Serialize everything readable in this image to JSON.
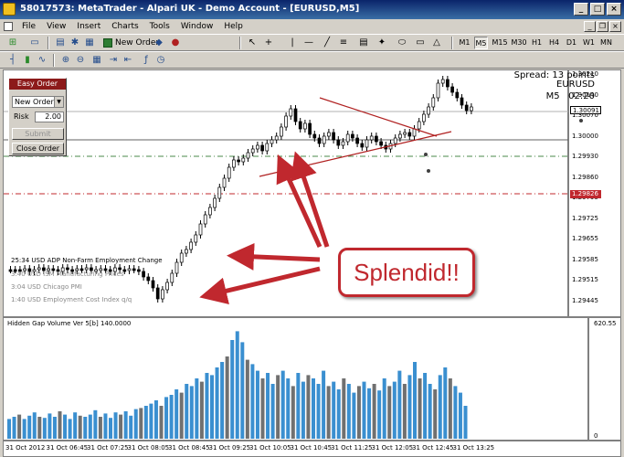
{
  "window": {
    "title": "58017573: MetaTrader - Alpari UK - Demo Account - [EURUSD,M5]"
  },
  "menu": [
    "File",
    "View",
    "Insert",
    "Charts",
    "Tools",
    "Window",
    "Help"
  ],
  "toolbar": {
    "new_order_label": "New Order",
    "timeframes": [
      "M1",
      "M5",
      "M15",
      "M30",
      "H1",
      "H4",
      "D1",
      "W1",
      "MN"
    ],
    "active_timeframe": "M5"
  },
  "chart": {
    "spread": "Spread: 13 points",
    "symbol": "EURUSD",
    "timeframe": "M5",
    "countdown": "02:20",
    "price_levels": [
      "1.30210",
      "1.30140",
      "1.30070",
      "1.30000",
      "1.29930",
      "1.29860",
      "1.29795",
      "1.29725",
      "1.29655",
      "1.29585",
      "1.29515",
      "1.29445"
    ],
    "current_price": "1.30091",
    "red_line_price": "1.29826",
    "news": [
      {
        "text": "25:34  USD  ADP Non-Farm Employment Change",
        "faded": false
      },
      {
        "text": "3:40  USD  ISM Manufacturing Prices",
        "faded": true
      },
      {
        "text": "3:04  USD  Chicago PMI",
        "faded": true
      },
      {
        "text": "1:40  USD  Employment Cost Index q/q",
        "faded": true
      }
    ],
    "annotation": "Splendid!!"
  },
  "easy_order": {
    "title": "Easy Order",
    "order_type": "New Order",
    "risk_label": "Risk",
    "risk_value": "2.00",
    "submit_label": "Submit",
    "close_label": "Close Order"
  },
  "indicator": {
    "title": "Hidden Gap Volume Ver 5[b] 140.0000",
    "max_label": "620.55",
    "zero_label": "0",
    "bars": [
      {
        "v": 0.18,
        "c": "b"
      },
      {
        "v": 0.2,
        "c": "b"
      },
      {
        "v": 0.22,
        "c": "g"
      },
      {
        "v": 0.18,
        "c": "b"
      },
      {
        "v": 0.21,
        "c": "b"
      },
      {
        "v": 0.24,
        "c": "b"
      },
      {
        "v": 0.2,
        "c": "g"
      },
      {
        "v": 0.19,
        "c": "b"
      },
      {
        "v": 0.23,
        "c": "b"
      },
      {
        "v": 0.2,
        "c": "b"
      },
      {
        "v": 0.25,
        "c": "g"
      },
      {
        "v": 0.22,
        "c": "b"
      },
      {
        "v": 0.18,
        "c": "b"
      },
      {
        "v": 0.24,
        "c": "b"
      },
      {
        "v": 0.21,
        "c": "g"
      },
      {
        "v": 0.2,
        "c": "b"
      },
      {
        "v": 0.22,
        "c": "b"
      },
      {
        "v": 0.26,
        "c": "b"
      },
      {
        "v": 0.2,
        "c": "g"
      },
      {
        "v": 0.23,
        "c": "b"
      },
      {
        "v": 0.19,
        "c": "b"
      },
      {
        "v": 0.24,
        "c": "b"
      },
      {
        "v": 0.22,
        "c": "g"
      },
      {
        "v": 0.25,
        "c": "b"
      },
      {
        "v": 0.21,
        "c": "b"
      },
      {
        "v": 0.27,
        "c": "b"
      },
      {
        "v": 0.28,
        "c": "g"
      },
      {
        "v": 0.3,
        "c": "b"
      },
      {
        "v": 0.32,
        "c": "b"
      },
      {
        "v": 0.35,
        "c": "b"
      },
      {
        "v": 0.3,
        "c": "g"
      },
      {
        "v": 0.38,
        "c": "b"
      },
      {
        "v": 0.4,
        "c": "b"
      },
      {
        "v": 0.45,
        "c": "b"
      },
      {
        "v": 0.42,
        "c": "g"
      },
      {
        "v": 0.5,
        "c": "b"
      },
      {
        "v": 0.48,
        "c": "b"
      },
      {
        "v": 0.55,
        "c": "b"
      },
      {
        "v": 0.52,
        "c": "g"
      },
      {
        "v": 0.6,
        "c": "b"
      },
      {
        "v": 0.58,
        "c": "b"
      },
      {
        "v": 0.65,
        "c": "b"
      },
      {
        "v": 0.7,
        "c": "b"
      },
      {
        "v": 0.75,
        "c": "g"
      },
      {
        "v": 0.9,
        "c": "b"
      },
      {
        "v": 0.98,
        "c": "b"
      },
      {
        "v": 0.88,
        "c": "b"
      },
      {
        "v": 0.72,
        "c": "g"
      },
      {
        "v": 0.68,
        "c": "b"
      },
      {
        "v": 0.62,
        "c": "b"
      },
      {
        "v": 0.55,
        "c": "g"
      },
      {
        "v": 0.6,
        "c": "b"
      },
      {
        "v": 0.5,
        "c": "b"
      },
      {
        "v": 0.58,
        "c": "g"
      },
      {
        "v": 0.62,
        "c": "b"
      },
      {
        "v": 0.55,
        "c": "b"
      },
      {
        "v": 0.48,
        "c": "g"
      },
      {
        "v": 0.6,
        "c": "b"
      },
      {
        "v": 0.52,
        "c": "b"
      },
      {
        "v": 0.58,
        "c": "g"
      },
      {
        "v": 0.55,
        "c": "b"
      },
      {
        "v": 0.5,
        "c": "b"
      },
      {
        "v": 0.62,
        "c": "b"
      },
      {
        "v": 0.48,
        "c": "g"
      },
      {
        "v": 0.52,
        "c": "b"
      },
      {
        "v": 0.45,
        "c": "b"
      },
      {
        "v": 0.55,
        "c": "g"
      },
      {
        "v": 0.5,
        "c": "b"
      },
      {
        "v": 0.42,
        "c": "b"
      },
      {
        "v": 0.48,
        "c": "g"
      },
      {
        "v": 0.52,
        "c": "b"
      },
      {
        "v": 0.46,
        "c": "b"
      },
      {
        "v": 0.5,
        "c": "g"
      },
      {
        "v": 0.44,
        "c": "b"
      },
      {
        "v": 0.55,
        "c": "b"
      },
      {
        "v": 0.48,
        "c": "g"
      },
      {
        "v": 0.52,
        "c": "b"
      },
      {
        "v": 0.62,
        "c": "b"
      },
      {
        "v": 0.5,
        "c": "g"
      },
      {
        "v": 0.58,
        "c": "b"
      },
      {
        "v": 0.7,
        "c": "b"
      },
      {
        "v": 0.55,
        "c": "g"
      },
      {
        "v": 0.6,
        "c": "b"
      },
      {
        "v": 0.5,
        "c": "b"
      },
      {
        "v": 0.45,
        "c": "g"
      },
      {
        "v": 0.58,
        "c": "b"
      },
      {
        "v": 0.65,
        "c": "b"
      },
      {
        "v": 0.55,
        "c": "g"
      },
      {
        "v": 0.48,
        "c": "b"
      },
      {
        "v": 0.42,
        "c": "b"
      },
      {
        "v": 0.3,
        "c": "b"
      }
    ]
  },
  "xaxis": [
    "31 Oct 2012",
    "31 Oct 06:45",
    "31 Oct 07:25",
    "31 Oct 08:05",
    "31 Oct 08:45",
    "31 Oct 09:25",
    "31 Oct 10:05",
    "31 Oct 10:45",
    "31 Oct 11:25",
    "31 Oct 12:05",
    "31 Oct 12:45",
    "31 Oct 13:25"
  ],
  "colors": {
    "bull": "#3a8fd0",
    "bear": "#707070",
    "annotation": "#c0282e",
    "title_bar": "#0a246a"
  }
}
